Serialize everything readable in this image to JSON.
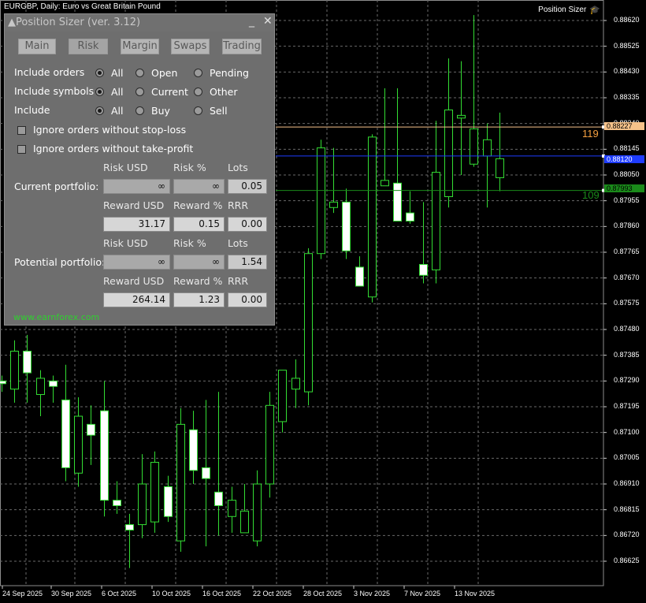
{
  "chart": {
    "title": "EURGBP, Daily:  Euro vs Great Britain Pound",
    "ps_button": "Position Sizer",
    "price_labels": [
      "0.88620",
      "0.88525",
      "0.88430",
      "0.88335",
      "0.88240",
      "0.88145",
      "0.88050",
      "0.87955",
      "0.87860",
      "0.87765",
      "0.87670",
      "0.87575",
      "0.87480",
      "0.87385",
      "0.87290",
      "0.87195",
      "0.87100",
      "0.87005",
      "0.86910",
      "0.86815",
      "0.86720",
      "0.86625"
    ],
    "date_labels": [
      "24 Sep 2025",
      "30 Sep 2025",
      "6 Oct 2025",
      "10 Oct 2025",
      "16 Oct 2025",
      "22 Oct 2025",
      "28 Oct 2025",
      "3 Nov 2025",
      "7 Nov 2025",
      "13 Nov 2025"
    ],
    "take_profit": {
      "price": "0.88227",
      "points": "119",
      "color": "#f5c28a"
    },
    "entry": {
      "price": "0.88120",
      "color": "#1e3cff"
    },
    "stop_loss": {
      "price": "0.87993",
      "points": "109",
      "color": "#1a8a1a"
    },
    "colors": {
      "bull": "#000000",
      "bear": "#ffffff",
      "wick": "#33dd33"
    },
    "candles": [
      [
        0.8729,
        0.8731,
        0.8725,
        0.8728
      ],
      [
        0.8726,
        0.8744,
        0.8721,
        0.874
      ],
      [
        0.874,
        0.8746,
        0.8721,
        0.8732
      ],
      [
        0.8724,
        0.8733,
        0.8716,
        0.873
      ],
      [
        0.8729,
        0.8731,
        0.8721,
        0.8727
      ],
      [
        0.8722,
        0.8735,
        0.8692,
        0.8697
      ],
      [
        0.8695,
        0.8723,
        0.869,
        0.8716
      ],
      [
        0.8713,
        0.872,
        0.8698,
        0.8709
      ],
      [
        0.8718,
        0.8729,
        0.8679,
        0.8685
      ],
      [
        0.8685,
        0.8692,
        0.868,
        0.8683
      ],
      [
        0.8676,
        0.868,
        0.866,
        0.8674
      ],
      [
        0.8676,
        0.8702,
        0.8671,
        0.8691
      ],
      [
        0.8677,
        0.8703,
        0.8673,
        0.8699
      ],
      [
        0.869,
        0.8694,
        0.8677,
        0.8679
      ],
      [
        0.867,
        0.8719,
        0.8666,
        0.8713
      ],
      [
        0.8711,
        0.8718,
        0.8691,
        0.8696
      ],
      [
        0.8697,
        0.8722,
        0.8668,
        0.8693
      ],
      [
        0.8688,
        0.8725,
        0.8672,
        0.8683
      ],
      [
        0.8679,
        0.869,
        0.8673,
        0.8685
      ],
      [
        0.8673,
        0.8691,
        0.8673,
        0.8681
      ],
      [
        0.867,
        0.8696,
        0.8668,
        0.8691
      ],
      [
        0.8691,
        0.8725,
        0.8686,
        0.872
      ],
      [
        0.8714,
        0.8733,
        0.871,
        0.8733
      ],
      [
        0.8726,
        0.8737,
        0.8719,
        0.873
      ],
      [
        0.8725,
        0.8778,
        0.872,
        0.8776
      ],
      [
        0.8776,
        0.8818,
        0.8774,
        0.8815
      ],
      [
        0.8793,
        0.8815,
        0.8791,
        0.8795
      ],
      [
        0.8795,
        0.88,
        0.8774,
        0.8777
      ],
      [
        0.8771,
        0.8775,
        0.8764,
        0.8764
      ],
      [
        0.876,
        0.882,
        0.8758,
        0.8819
      ],
      [
        0.8801,
        0.8837,
        0.8801,
        0.8803
      ],
      [
        0.8802,
        0.8837,
        0.8788,
        0.8788
      ],
      [
        0.8791,
        0.8799,
        0.8787,
        0.8788
      ],
      [
        0.8772,
        0.8795,
        0.8765,
        0.8768
      ],
      [
        0.877,
        0.8825,
        0.8765,
        0.8806
      ],
      [
        0.8797,
        0.8848,
        0.8793,
        0.8829
      ],
      [
        0.8826,
        0.8847,
        0.8805,
        0.8827
      ],
      [
        0.8809,
        0.8864,
        0.8808,
        0.8822
      ],
      [
        0.8812,
        0.8824,
        0.8793,
        0.8818
      ],
      [
        0.8804,
        0.8828,
        0.8799,
        0.8811
      ]
    ]
  },
  "panel": {
    "title": "Position Sizer (ver. 3.12)",
    "minimize": "_",
    "close": "✕",
    "tabs": [
      {
        "label": "Main",
        "active": false
      },
      {
        "label": "Risk",
        "active": true
      },
      {
        "label": "Margin",
        "active": false
      },
      {
        "label": "Swaps",
        "active": false
      },
      {
        "label": "Trading",
        "active": false
      }
    ],
    "include_orders": {
      "label": "Include orders",
      "options": [
        "All",
        "Open",
        "Pending"
      ],
      "selected": 0
    },
    "include_symbols": {
      "label": "Include symbols",
      "options": [
        "All",
        "Current",
        "Other"
      ],
      "selected": 0
    },
    "include": {
      "label": "Include",
      "options": [
        "All",
        "Buy",
        "Sell"
      ],
      "selected": 0
    },
    "ignore_sl": "Ignore orders without stop-loss",
    "ignore_tp": "Ignore orders without take-profit",
    "col_risk_usd": "Risk USD",
    "col_risk_pct": "Risk %",
    "col_lots": "Lots",
    "col_reward_usd": "Reward USD",
    "col_reward_pct": "Reward %",
    "col_rrr": "RRR",
    "current": {
      "label": "Current portfolio:",
      "risk_usd": "∞",
      "risk_pct": "∞",
      "lots": "0.05",
      "reward_usd": "31.17",
      "reward_pct": "0.15",
      "rrr": "0.00"
    },
    "potential": {
      "label": "Potential portfolio:",
      "risk_usd": "∞",
      "risk_pct": "∞",
      "lots": "1.54",
      "reward_usd": "264.14",
      "reward_pct": "1.23",
      "rrr": "0.00"
    },
    "link": "www.earnforex.com"
  }
}
